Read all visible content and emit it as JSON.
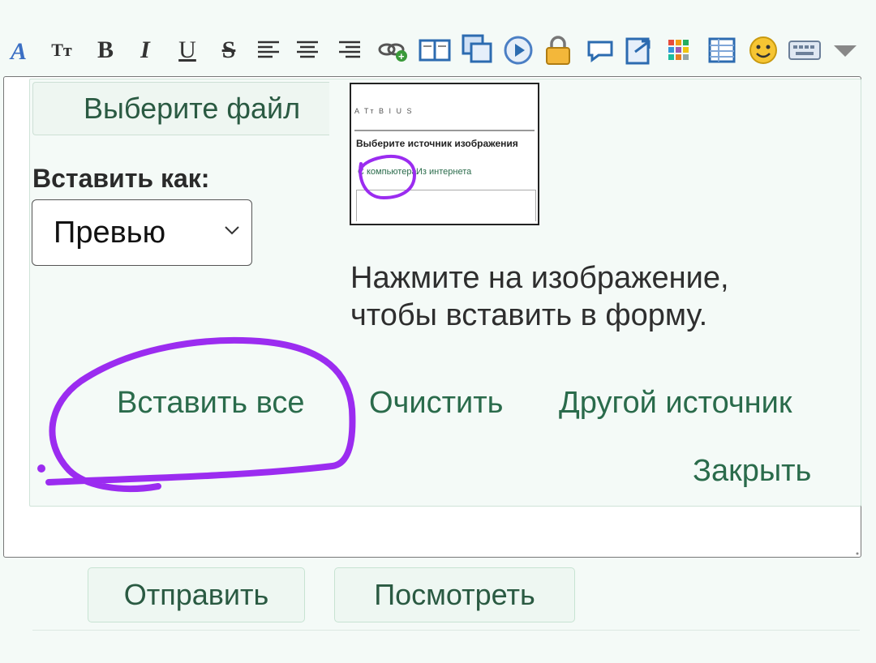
{
  "toolbar": {
    "icons": [
      "text-color-icon",
      "font-size-icon",
      "bold-icon",
      "italic-icon",
      "underline-icon",
      "strikethrough-icon",
      "align-left-icon",
      "align-center-icon",
      "align-right-icon",
      "link-icon",
      "book-icon",
      "copy-icon",
      "play-icon",
      "lock-icon",
      "speech-bubble-icon",
      "export-icon",
      "color-grid-icon",
      "table-icon",
      "smiley-icon",
      "keyboard-icon",
      "more-dropdown-icon"
    ],
    "font_size_glyph": "Tт",
    "bold_glyph": "B",
    "italic_glyph": "I",
    "underline_glyph": "U",
    "strike_glyph": "S"
  },
  "panel": {
    "choose_file_label": "Выберите файл",
    "insert_as_label": "Вставить как:",
    "insert_as_value": "Превью",
    "hint_line1": "Нажмите на изображение,",
    "hint_line2": "чтобы вставить в форму.",
    "insert_all_link": "Вставить все",
    "clear_link": "Очистить",
    "other_source_link": "Другой источник",
    "close_link": "Закрыть"
  },
  "thumbnail": {
    "toolbar_glyphs": "A Tт B I U S",
    "title": "Выберите источник изображения",
    "tab_computer": "С компьютера",
    "tab_internet": "Из интернета"
  },
  "form": {
    "submit_button": "Отправить",
    "preview_button": "Посмотреть"
  },
  "colors": {
    "accent_green": "#2a6b4b",
    "panel_bg": "#f4faf7",
    "scribble_purple": "#9b2cf0"
  }
}
